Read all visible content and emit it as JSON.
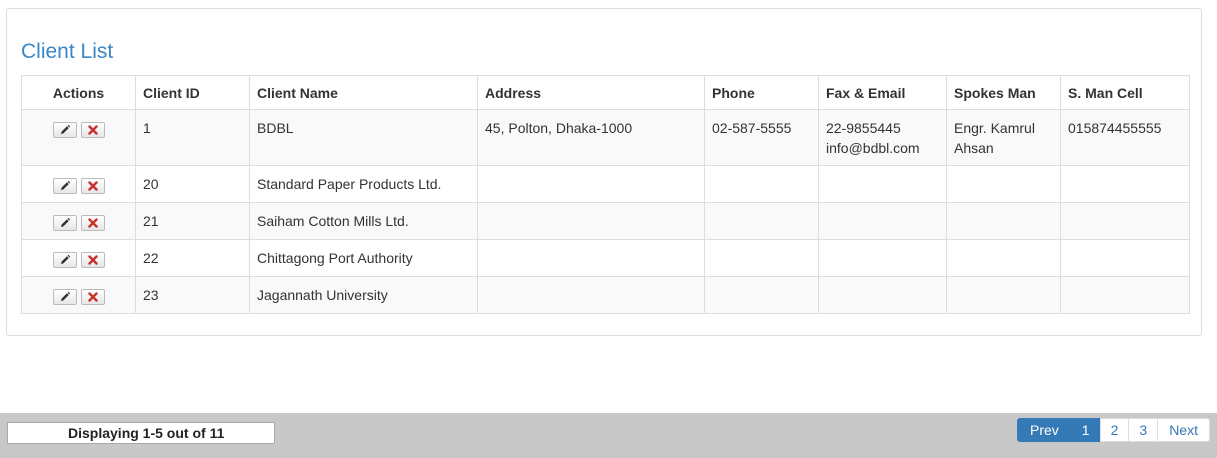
{
  "page": {
    "title": "Client List"
  },
  "table": {
    "headers": [
      "Actions",
      "Client ID",
      "Client Name",
      "Address",
      "Phone",
      "Fax & Email",
      "Spokes Man",
      "S. Man Cell"
    ],
    "rows": [
      {
        "id": "1",
        "name": "BDBL",
        "address": "45, Polton, Dhaka-1000",
        "phone": "02-587-5555",
        "fax": "22-9855445",
        "email": "info@bdbl.com",
        "spokesman_line1": "Engr. Kamrul",
        "spokesman_line2": "Ahsan",
        "cell": "015874455555"
      },
      {
        "id": "20",
        "name": "Standard Paper Products Ltd.",
        "address": "",
        "phone": "",
        "fax": "",
        "email": "",
        "spokesman_line1": "",
        "spokesman_line2": "",
        "cell": ""
      },
      {
        "id": "21",
        "name": "Saiham Cotton Mills Ltd.",
        "address": "",
        "phone": "",
        "fax": "",
        "email": "",
        "spokesman_line1": "",
        "spokesman_line2": "",
        "cell": ""
      },
      {
        "id": "22",
        "name": "Chittagong Port Authority",
        "address": "",
        "phone": "",
        "fax": "",
        "email": "",
        "spokesman_line1": "",
        "spokesman_line2": "",
        "cell": ""
      },
      {
        "id": "23",
        "name": "Jagannath University",
        "address": "",
        "phone": "",
        "fax": "",
        "email": "",
        "spokesman_line1": "",
        "spokesman_line2": "",
        "cell": ""
      }
    ]
  },
  "icons": {
    "edit": "pencil-icon",
    "delete": "close-icon"
  },
  "footer": {
    "status": "Displaying 1-5 out of 11",
    "pagination": {
      "prev": "Prev",
      "pages": [
        "1",
        "2",
        "3"
      ],
      "current": "1",
      "next": "Next"
    }
  },
  "colors": {
    "title": "#3a87c8",
    "active_page": "#337ab7",
    "delete_icon": "#c9302c",
    "footer_bg": "#c8c8c8"
  }
}
